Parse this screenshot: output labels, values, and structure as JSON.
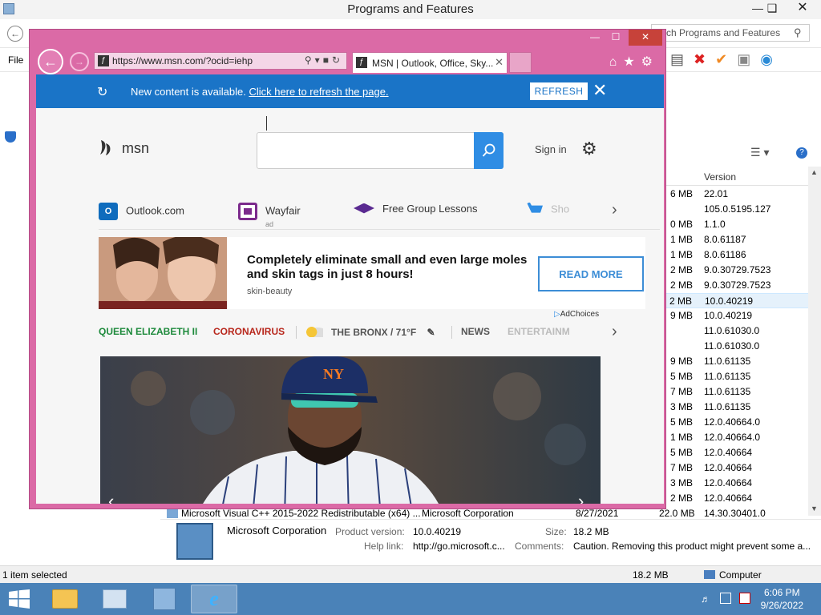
{
  "pf_window": {
    "title": "Programs and Features",
    "search_placeholder": "rch Programs and Features",
    "menu_file": "File",
    "column_version": "Version",
    "rows": [
      {
        "size": "6 MB",
        "version": "22.01"
      },
      {
        "size": "",
        "version": "105.0.5195.127"
      },
      {
        "size": "0 MB",
        "version": "1.1.0"
      },
      {
        "size": "1 MB",
        "version": "8.0.61187"
      },
      {
        "size": "1 MB",
        "version": "8.0.61186"
      },
      {
        "size": "2 MB",
        "version": "9.0.30729.7523"
      },
      {
        "size": "2 MB",
        "version": "9.0.30729.7523"
      },
      {
        "size": "2 MB",
        "version": "10.0.40219"
      },
      {
        "size": "9 MB",
        "version": "10.0.40219"
      },
      {
        "size": "",
        "version": "11.0.61030.0"
      },
      {
        "size": "",
        "version": "11.0.61030.0"
      },
      {
        "size": "9 MB",
        "version": "11.0.61135"
      },
      {
        "size": "5 MB",
        "version": "11.0.61135"
      },
      {
        "size": "7 MB",
        "version": "11.0.61135"
      },
      {
        "size": "3 MB",
        "version": "11.0.61135"
      },
      {
        "size": "5 MB",
        "version": "12.0.40664.0"
      },
      {
        "size": "1 MB",
        "version": "12.0.40664.0"
      },
      {
        "size": "5 MB",
        "version": "12.0.40664"
      },
      {
        "size": "7 MB",
        "version": "12.0.40664"
      },
      {
        "size": "3 MB",
        "version": "12.0.40664"
      },
      {
        "size": "2 MB",
        "version": "12.0.40664"
      }
    ],
    "bottom_row": {
      "name": "Microsoft Visual C++ 2015-2022 Redistributable (x64) ...",
      "publisher": "Microsoft Corporation",
      "date": "8/27/2021",
      "size": "22.0 MB",
      "version": "14.30.30401.0"
    },
    "details": {
      "publisher": "Microsoft Corporation",
      "product_version_label": "Product version:",
      "product_version": "10.0.40219",
      "size_label": "Size:",
      "size": "18.2 MB",
      "help_label": "Help link:",
      "help": "http://go.microsoft.c...",
      "comments_label": "Comments:",
      "comments": "Caution. Removing this product might prevent some a..."
    },
    "status": {
      "selected": "1 item selected",
      "size": "18.2 MB",
      "location": "Computer"
    }
  },
  "taskbar": {
    "time": "6:06 PM",
    "date": "9/26/2022"
  },
  "ie": {
    "url": "https://www.msn.com/?ocid=iehp",
    "tab_title": "MSN | Outlook, Office, Sky...",
    "notification": {
      "text": "New content is available.",
      "link": "Click here to refresh the page.",
      "button": "REFRESH"
    },
    "msn": {
      "logo": "msn",
      "signin": "Sign in",
      "quicklinks": [
        "Outlook.com",
        "Wayfair",
        "Free Group Lessons",
        "Sho"
      ],
      "ql_ad": "ad",
      "ad": {
        "headline": "Completely eliminate small and even large moles and skin tags in just 8 hours!",
        "source": "skin-beauty",
        "button": "READ MORE",
        "adchoices": "AdChoices"
      },
      "newsnav": {
        "item1": "QUEEN ELIZABETH II",
        "item2": "CORONAVIRUS",
        "weather": "THE BRONX / 71°F",
        "news": "NEWS",
        "ent": "ENTERTAINM"
      }
    }
  }
}
